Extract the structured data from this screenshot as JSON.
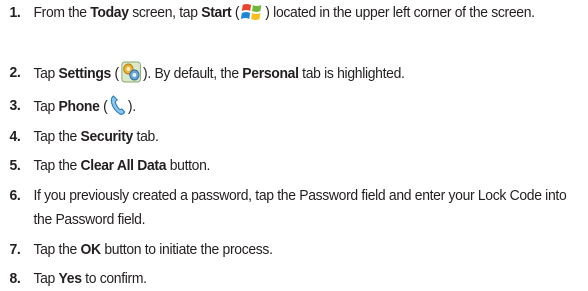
{
  "steps": [
    {
      "num": "1.",
      "parts": {
        "a": "From the ",
        "b1": "Today",
        "c": " screen, tap ",
        "b2": "Start",
        "d": " (",
        "e": ") located in the upper left corner of the screen."
      },
      "icon": "windows-start-icon"
    },
    {
      "num": "2.",
      "parts": {
        "a": "Tap ",
        "b1": "Settings",
        "c": " (",
        "d": "). By default, the ",
        "b2": "Personal",
        "e": " tab is highlighted."
      },
      "icon": "settings-gear-icon"
    },
    {
      "num": "3.",
      "parts": {
        "a": "Tap ",
        "b1": "Phone",
        "c": " (",
        "d": ")."
      },
      "icon": "phone-handset-icon"
    },
    {
      "num": "4.",
      "parts": {
        "a": "Tap the ",
        "b1": "Security",
        "c": " tab."
      }
    },
    {
      "num": "5.",
      "parts": {
        "a": "Tap the ",
        "b1": "Clear All Data",
        "c": " button."
      }
    },
    {
      "num": "6.",
      "parts": {
        "a": "If you previously created a password, tap the Password field and enter your Lock Code into the Password field."
      }
    },
    {
      "num": "7.",
      "parts": {
        "a": "Tap the ",
        "b1": "OK",
        "c": " button to initiate the process."
      }
    },
    {
      "num": "8.",
      "parts": {
        "a": "Tap ",
        "b1": "Yes",
        "c": " to confirm."
      }
    }
  ]
}
